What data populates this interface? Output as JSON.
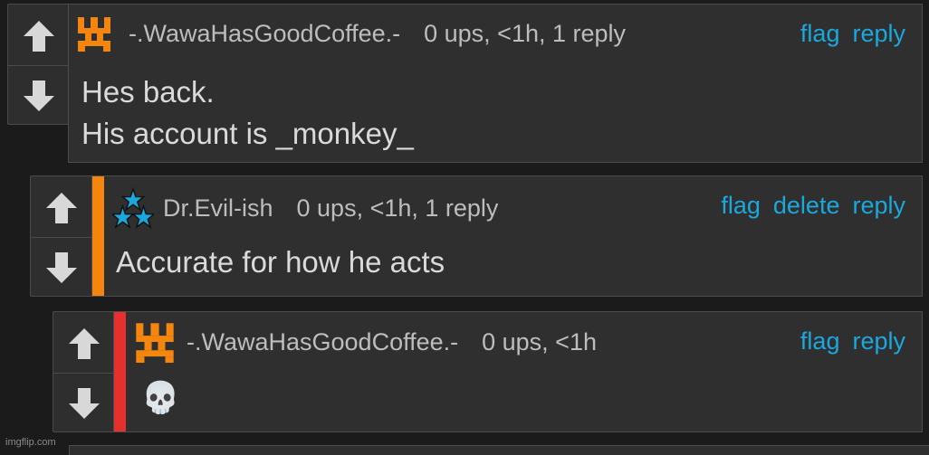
{
  "colors": {
    "link": "#1aa8dd",
    "stripe_level2": "#f5860d",
    "stripe_level3": "#e5302d",
    "panel": "#2f2f2f",
    "arrow": "#d8d8d8"
  },
  "comments": [
    {
      "avatar": "orange-castle-glyph-icon",
      "username": "-.WawaHasGoodCoffee.-",
      "stats": "0 ups, <1h, 1 reply",
      "actions": [
        "flag",
        "reply"
      ],
      "body": [
        "Hes back.",
        "His account is _monkey_"
      ]
    },
    {
      "avatar": "three-blue-stars-icon",
      "username": "Dr.Evil-ish",
      "stats": "0 ups, <1h, 1 reply",
      "actions": [
        "flag",
        "delete",
        "reply"
      ],
      "body": [
        "Accurate for how he acts"
      ]
    },
    {
      "avatar": "orange-castle-glyph-icon",
      "username": "-.WawaHasGoodCoffee.-",
      "stats": "0 ups, <1h",
      "actions": [
        "flag",
        "reply"
      ],
      "body": [
        "💀"
      ]
    }
  ],
  "watermark": "imgflip.com"
}
